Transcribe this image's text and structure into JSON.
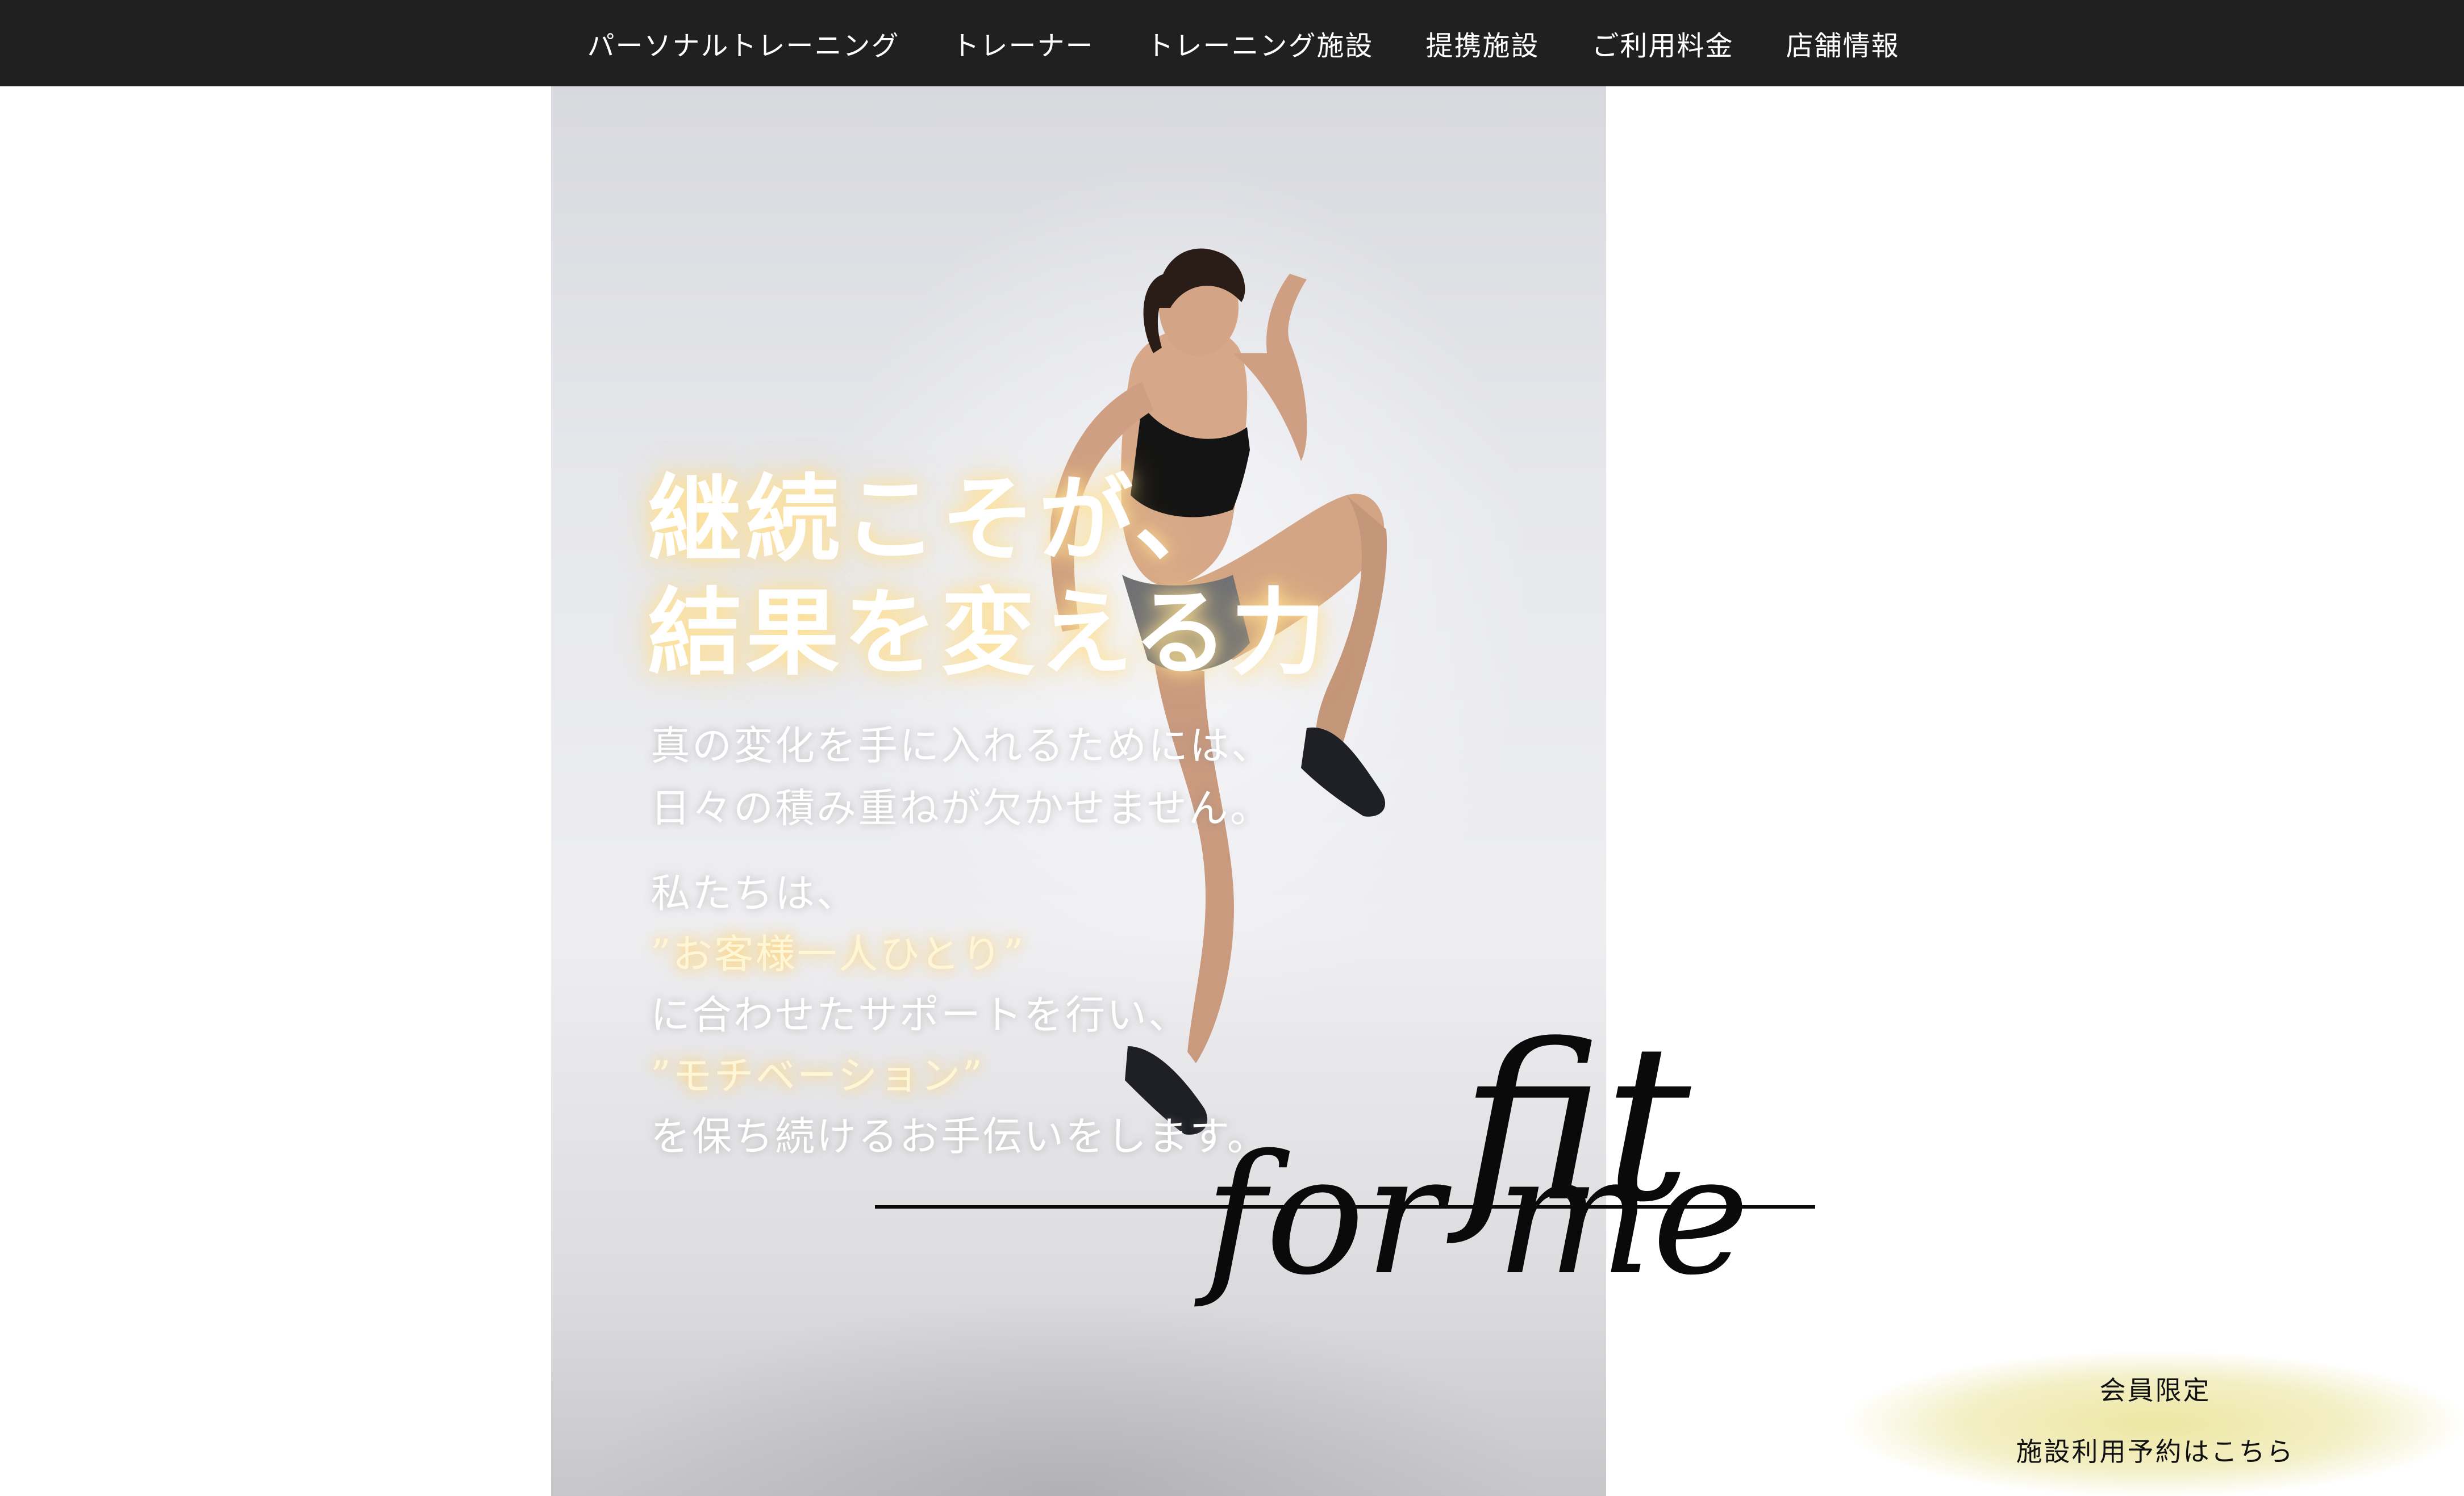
{
  "nav": {
    "items": [
      {
        "label": "パーソナルトレーニング"
      },
      {
        "label": "トレーナー"
      },
      {
        "label": "トレーニング施設"
      },
      {
        "label": "提携施設"
      },
      {
        "label": "ご利用料金"
      },
      {
        "label": "店舗情報"
      }
    ]
  },
  "hero": {
    "headline": {
      "line1": "継続こそが、",
      "line2": "結果を変える力"
    },
    "intro": {
      "line1": "真の変化を手に入れるためには、",
      "line2": "日々の積み重ねが欠かせません。"
    },
    "body": {
      "line1": "私たちは、",
      "line2": "”お客様一人ひとり”",
      "line3": "に合わせたサポートを行い、",
      "line4": "”モチベーション”",
      "line5": "を保ち続けるお手伝いをします。"
    }
  },
  "logo": {
    "word1": "fit",
    "word2": "for me"
  },
  "reserve": {
    "line1": "会員限定",
    "line2": "施設利用予約はこちら"
  },
  "colors": {
    "nav_bg": "#202020",
    "headline_glow": "#ffe296",
    "accent_glow": "#ffd26e",
    "reserve_bg": "#ede7a2"
  }
}
